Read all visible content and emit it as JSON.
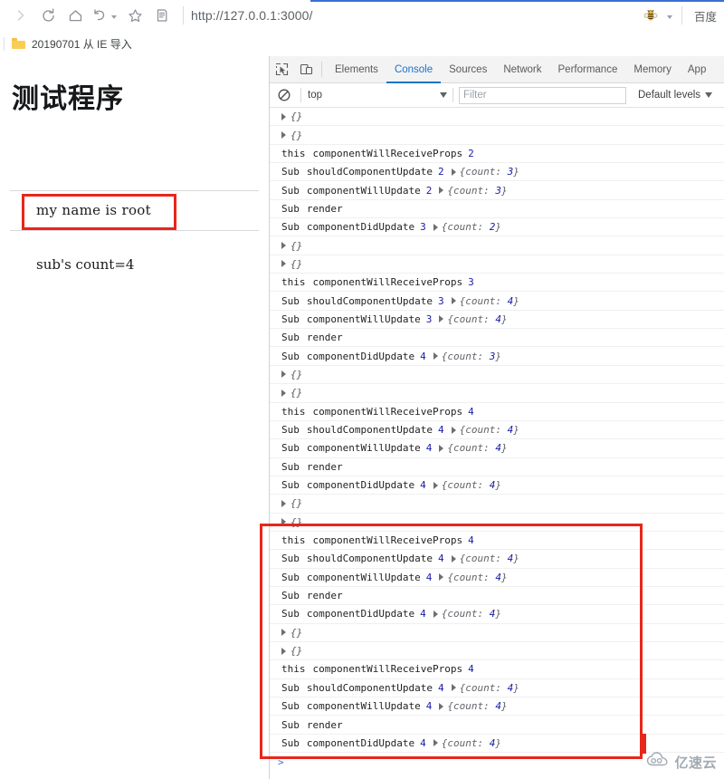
{
  "browser": {
    "toolbar": {
      "forward_icon": "forward-arrow-icon",
      "reload_icon": "reload-icon",
      "home_icon": "home-icon",
      "history_back_icon": "history-undo-icon",
      "bookmark_star_icon": "star-icon",
      "reading_list_icon": "reading-list-icon",
      "url": "http://127.0.0.1:3000/",
      "extension_icon": "bee-icon",
      "extension_caret_icon": "chevron-down-icon",
      "search_engine_label": "百度"
    },
    "bookmarks": {
      "folder_icon": "folder-icon",
      "items": [
        {
          "label": "20190701 从 IE 导入"
        }
      ]
    }
  },
  "page": {
    "heading": "测试程序",
    "name_line": "my  name is  root",
    "count_line": "sub's count=4"
  },
  "devtools": {
    "inspect_icon": "inspect-element-icon",
    "device_toolbar_icon": "device-toolbar-icon",
    "tabs": [
      {
        "label": "Elements",
        "active": false
      },
      {
        "label": "Console",
        "active": true
      },
      {
        "label": "Sources",
        "active": false
      },
      {
        "label": "Network",
        "active": false
      },
      {
        "label": "Performance",
        "active": false
      },
      {
        "label": "Memory",
        "active": false
      },
      {
        "label": "App",
        "active": false
      }
    ],
    "filterbar": {
      "clear_icon": "clear-console-icon",
      "context_value": "top",
      "context_caret_icon": "chevron-down-icon",
      "filter_placeholder": "Filter",
      "filter_value": "",
      "levels_value": "Default levels",
      "levels_caret_icon": "chevron-down-icon"
    },
    "prompt_icon": "console-prompt-arrow-icon",
    "console_rows": [
      {
        "type": "object",
        "text": "{}"
      },
      {
        "type": "object",
        "text": "{}"
      },
      {
        "type": "log",
        "label": "this",
        "hook": "componentWillReceiveProps",
        "num": "2"
      },
      {
        "type": "log",
        "label": "Sub",
        "hook": "shouldComponentUpdate",
        "num": "2",
        "obj_pre": "{count: ",
        "obj_num": "3",
        "obj_post": "}"
      },
      {
        "type": "log",
        "label": "Sub",
        "hook": "componentWillUpdate",
        "num": "2",
        "obj_pre": "{count: ",
        "obj_num": "3",
        "obj_post": "}"
      },
      {
        "type": "plain",
        "label": "Sub",
        "hook": "render"
      },
      {
        "type": "log",
        "label": "Sub",
        "hook": "componentDidUpdate",
        "num": "3",
        "obj_pre": "{count: ",
        "obj_num": "2",
        "obj_post": "}"
      },
      {
        "type": "object",
        "text": "{}"
      },
      {
        "type": "object",
        "text": "{}"
      },
      {
        "type": "log",
        "label": "this",
        "hook": "componentWillReceiveProps",
        "num": "3"
      },
      {
        "type": "log",
        "label": "Sub",
        "hook": "shouldComponentUpdate",
        "num": "3",
        "obj_pre": "{count: ",
        "obj_num": "4",
        "obj_post": "}"
      },
      {
        "type": "log",
        "label": "Sub",
        "hook": "componentWillUpdate",
        "num": "3",
        "obj_pre": "{count: ",
        "obj_num": "4",
        "obj_post": "}"
      },
      {
        "type": "plain",
        "label": "Sub",
        "hook": "render"
      },
      {
        "type": "log",
        "label": "Sub",
        "hook": "componentDidUpdate",
        "num": "4",
        "obj_pre": "{count: ",
        "obj_num": "3",
        "obj_post": "}"
      },
      {
        "type": "object",
        "text": "{}"
      },
      {
        "type": "object",
        "text": "{}"
      },
      {
        "type": "log",
        "label": "this",
        "hook": "componentWillReceiveProps",
        "num": "4"
      },
      {
        "type": "log",
        "label": "Sub",
        "hook": "shouldComponentUpdate",
        "num": "4",
        "obj_pre": "{count: ",
        "obj_num": "4",
        "obj_post": "}"
      },
      {
        "type": "log",
        "label": "Sub",
        "hook": "componentWillUpdate",
        "num": "4",
        "obj_pre": "{count: ",
        "obj_num": "4",
        "obj_post": "}"
      },
      {
        "type": "plain",
        "label": "Sub",
        "hook": "render"
      },
      {
        "type": "log",
        "label": "Sub",
        "hook": "componentDidUpdate",
        "num": "4",
        "obj_pre": "{count: ",
        "obj_num": "4",
        "obj_post": "}"
      },
      {
        "type": "object",
        "text": "{}"
      },
      {
        "type": "object",
        "text": "{}"
      },
      {
        "type": "log",
        "label": "this",
        "hook": "componentWillReceiveProps",
        "num": "4"
      },
      {
        "type": "log",
        "label": "Sub",
        "hook": "shouldComponentUpdate",
        "num": "4",
        "obj_pre": "{count: ",
        "obj_num": "4",
        "obj_post": "}"
      },
      {
        "type": "log",
        "label": "Sub",
        "hook": "componentWillUpdate",
        "num": "4",
        "obj_pre": "{count: ",
        "obj_num": "4",
        "obj_post": "}"
      },
      {
        "type": "plain",
        "label": "Sub",
        "hook": "render"
      },
      {
        "type": "log",
        "label": "Sub",
        "hook": "componentDidUpdate",
        "num": "4",
        "obj_pre": "{count: ",
        "obj_num": "4",
        "obj_post": "}"
      },
      {
        "type": "object",
        "text": "{}"
      },
      {
        "type": "object",
        "text": "{}"
      },
      {
        "type": "log",
        "label": "this",
        "hook": "componentWillReceiveProps",
        "num": "4"
      },
      {
        "type": "log",
        "label": "Sub",
        "hook": "shouldComponentUpdate",
        "num": "4",
        "obj_pre": "{count: ",
        "obj_num": "4",
        "obj_post": "}"
      },
      {
        "type": "log",
        "label": "Sub",
        "hook": "componentWillUpdate",
        "num": "4",
        "obj_pre": "{count: ",
        "obj_num": "4",
        "obj_post": "}"
      },
      {
        "type": "plain",
        "label": "Sub",
        "hook": "render"
      },
      {
        "type": "log",
        "label": "Sub",
        "hook": "componentDidUpdate",
        "num": "4",
        "obj_pre": "{count: ",
        "obj_num": "4",
        "obj_post": "}"
      }
    ]
  },
  "annotations": {
    "highlight_color": "#e8261b",
    "name_box": "red-highlight-around-name-output",
    "console_box": "red-highlight-around-repeated-logs"
  },
  "watermark": {
    "logo_icon": "cloud-logo-icon",
    "text": "亿速云"
  }
}
